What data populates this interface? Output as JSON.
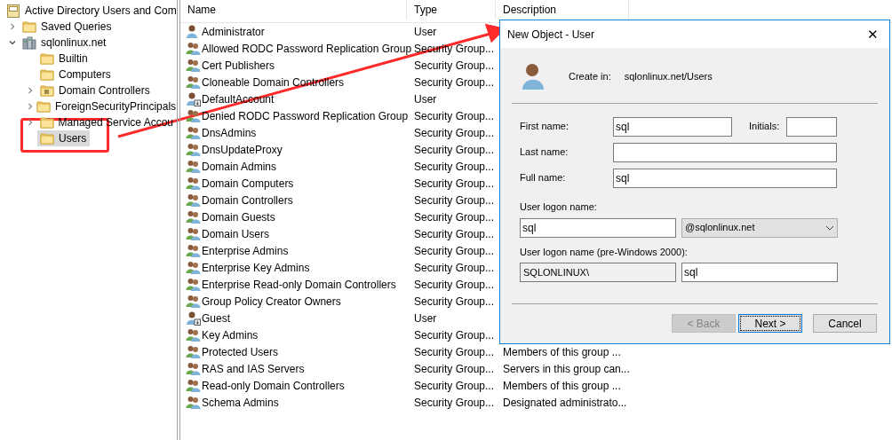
{
  "tree": {
    "label": "Active Directory Users and Com",
    "children": [
      {
        "label": "Saved Queries",
        "kind": "container",
        "expanded": false,
        "selected": false
      },
      {
        "label": "sqlonlinux.net",
        "kind": "domain",
        "expanded": true,
        "selected": false,
        "children": [
          {
            "label": "Builtin",
            "kind": "folder",
            "expanded": false,
            "selected": false
          },
          {
            "label": "Computers",
            "kind": "folder",
            "expanded": false,
            "selected": false
          },
          {
            "label": "Domain Controllers",
            "kind": "unit",
            "expanded": false,
            "selected": false
          },
          {
            "label": "ForeignSecurityPrincipals",
            "kind": "container",
            "expanded": false,
            "selected": false
          },
          {
            "label": "Managed Service Accou",
            "kind": "container",
            "expanded": false,
            "selected": false
          },
          {
            "label": "Users",
            "kind": "folder",
            "expanded": false,
            "selected": true
          }
        ]
      }
    ]
  },
  "table": {
    "columns": [
      "Name",
      "Type",
      "Description"
    ],
    "rows": [
      {
        "kind": "user",
        "name": "Administrator",
        "type": "User"
      },
      {
        "kind": "group",
        "name": "Allowed RODC Password Replication Group",
        "type": "Security Group..."
      },
      {
        "kind": "group",
        "name": "Cert Publishers",
        "type": "Security Group..."
      },
      {
        "kind": "group",
        "name": "Cloneable Domain Controllers",
        "type": "Security Group..."
      },
      {
        "kind": "disabled_user",
        "name": "DefaultAccount",
        "type": "User"
      },
      {
        "kind": "group",
        "name": "Denied RODC Password Replication Group",
        "type": "Security Group..."
      },
      {
        "kind": "group",
        "name": "DnsAdmins",
        "type": "Security Group..."
      },
      {
        "kind": "group",
        "name": "DnsUpdateProxy",
        "type": "Security Group..."
      },
      {
        "kind": "group",
        "name": "Domain Admins",
        "type": "Security Group..."
      },
      {
        "kind": "group",
        "name": "Domain Computers",
        "type": "Security Group..."
      },
      {
        "kind": "group",
        "name": "Domain Controllers",
        "type": "Security Group..."
      },
      {
        "kind": "group",
        "name": "Domain Guests",
        "type": "Security Group..."
      },
      {
        "kind": "group",
        "name": "Domain Users",
        "type": "Security Group..."
      },
      {
        "kind": "group",
        "name": "Enterprise Admins",
        "type": "Security Group..."
      },
      {
        "kind": "group",
        "name": "Enterprise Key Admins",
        "type": "Security Group..."
      },
      {
        "kind": "group",
        "name": "Enterprise Read-only Domain Controllers",
        "type": "Security Group..."
      },
      {
        "kind": "group",
        "name": "Group Policy Creator Owners",
        "type": "Security Group..."
      },
      {
        "kind": "disabled_user",
        "name": "Guest",
        "type": "User"
      },
      {
        "kind": "group",
        "name": "Key Admins",
        "type": "Security Group..."
      },
      {
        "kind": "group",
        "name": "Protected Users",
        "type": "Security Group...",
        "description": "Members of this group ..."
      },
      {
        "kind": "group",
        "name": "RAS and IAS Servers",
        "type": "Security Group...",
        "description": "Servers in this group can..."
      },
      {
        "kind": "group",
        "name": "Read-only Domain Controllers",
        "type": "Security Group...",
        "description": "Members of this group ..."
      },
      {
        "kind": "group",
        "name": "Schema Admins",
        "type": "Security Group...",
        "description": "Designated administrato..."
      }
    ]
  },
  "dialog": {
    "title": "New Object - User",
    "close": "✕",
    "create_in_label": "Create in:",
    "create_in_value": "sqlonlinux.net/Users",
    "first_name": {
      "label": "First name:",
      "value": "sql"
    },
    "initials": {
      "label": "Initials:"
    },
    "last_name": {
      "label": "Last name:"
    },
    "full_name": {
      "label": "Full name:",
      "value": "sql"
    },
    "logon_name": {
      "label": "User logon name:",
      "value": "sql",
      "domain": "@sqlonlinux.net"
    },
    "pre2000": {
      "label": "User logon name (pre-Windows 2000):",
      "prefix": "SQLONLINUX\\",
      "value": "sql"
    },
    "buttons": [
      {
        "label": "< Back",
        "disabled": true,
        "default": false
      },
      {
        "label": "Next >",
        "disabled": false,
        "default": true
      },
      {
        "label": "Cancel",
        "disabled": false,
        "default": false
      }
    ]
  }
}
